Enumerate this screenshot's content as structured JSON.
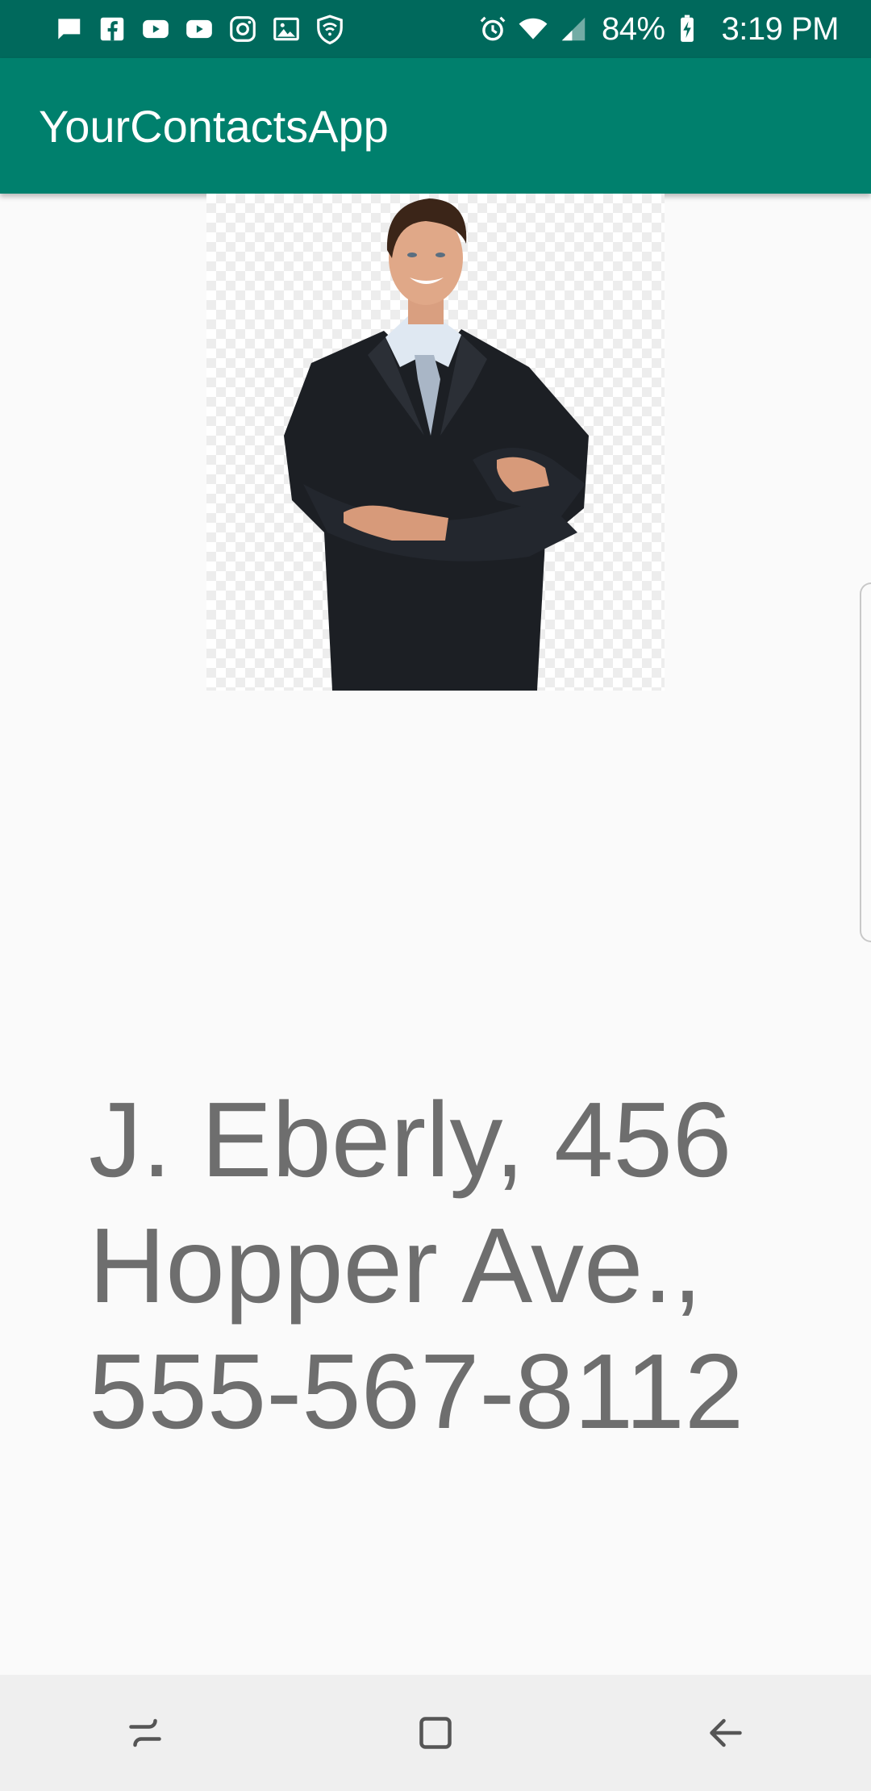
{
  "status_bar": {
    "battery": "84%",
    "time": "3:19 PM",
    "left_icons": [
      "message-icon",
      "facebook-icon",
      "youtube-icon",
      "youtube-icon",
      "instagram-icon",
      "gallery-icon",
      "wifi-shield-icon"
    ],
    "right_icons": [
      "alarm-icon",
      "wifi-icon",
      "signal-icon",
      "battery-charging-icon"
    ]
  },
  "app_bar": {
    "title": "YourContactsApp"
  },
  "contact": {
    "photo_icon": "contact-photo",
    "details": "J. Eberly, 456 Hopper Ave., 555-567-8112"
  },
  "nav_bar": {
    "buttons": [
      "recent-apps-icon",
      "home-icon",
      "back-icon"
    ]
  },
  "colors": {
    "status_bar": "#00695c",
    "app_bar": "#00806d",
    "background": "#fafafa",
    "text": "#6e6e6e",
    "nav_bar": "#efefef"
  }
}
